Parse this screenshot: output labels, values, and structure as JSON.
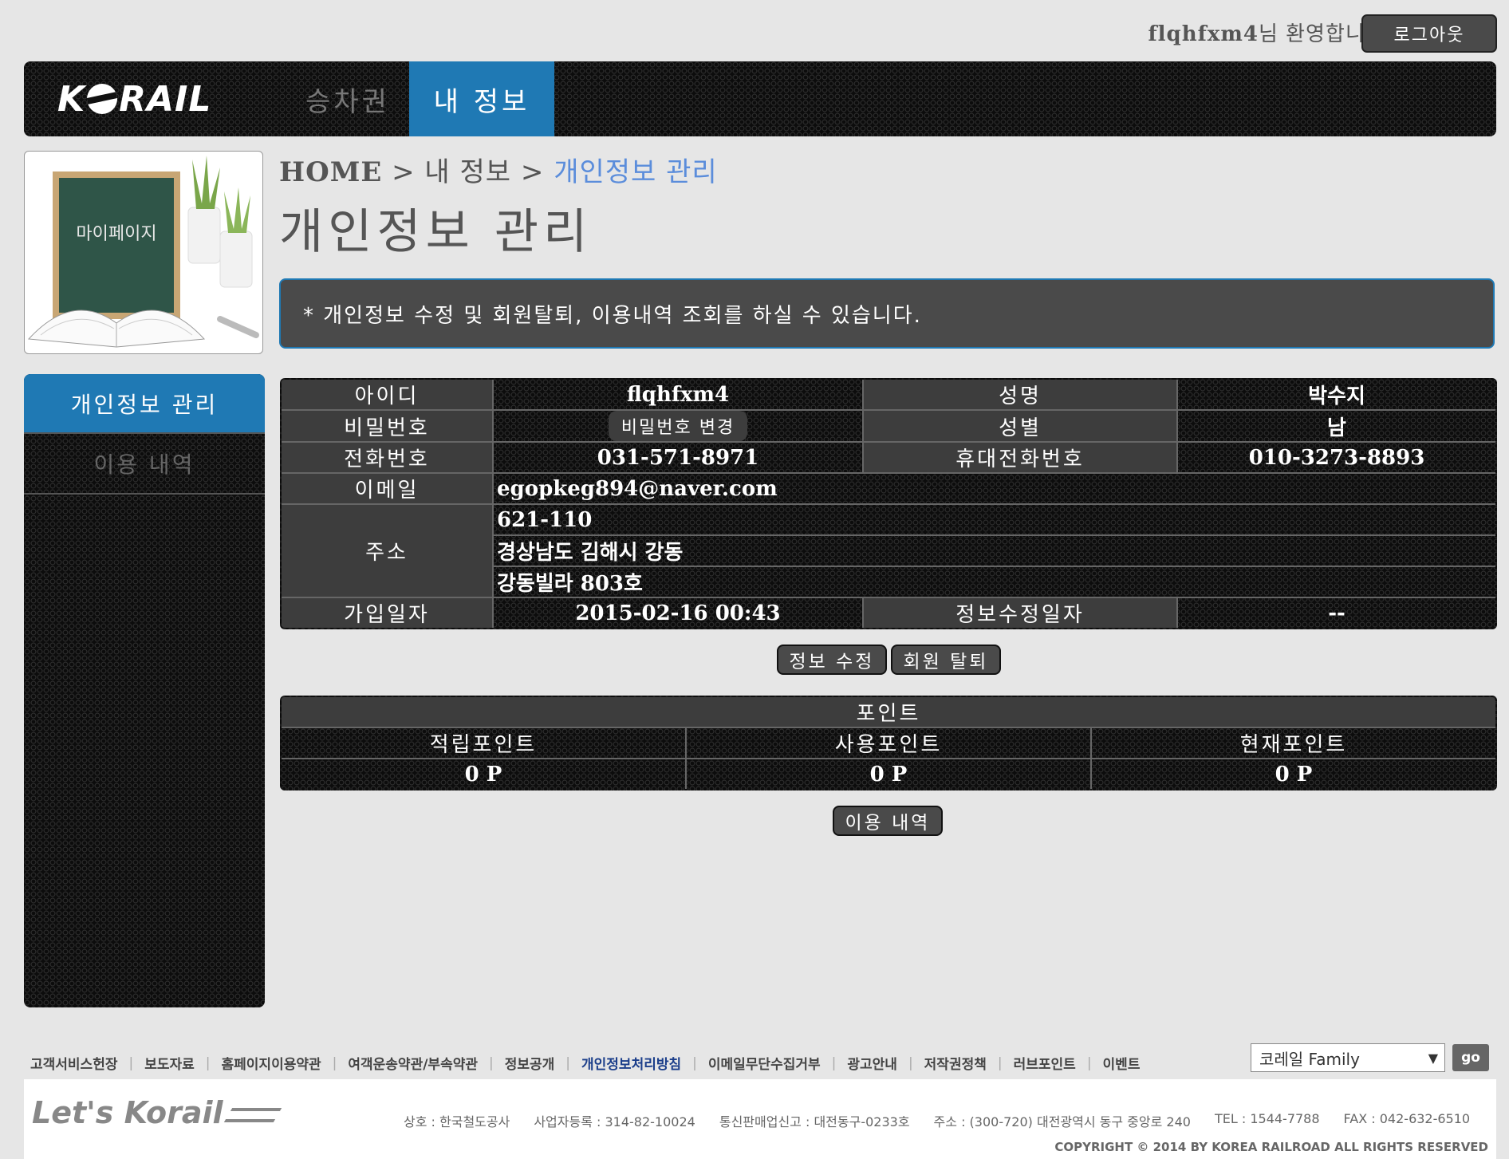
{
  "header": {
    "username": "flqhfxm4",
    "welcome_suffix": "님 환영합니다.",
    "logout_label": "로그아웃"
  },
  "nav": {
    "logo_text": "KORAIL",
    "tabs": [
      {
        "label": "승차권",
        "active": false
      },
      {
        "label": "내 정보",
        "active": true
      }
    ]
  },
  "side_image": {
    "chalkboard_text": "마이페이지"
  },
  "breadcrumb": {
    "home": "HOME",
    "sep": ">",
    "section": "내 정보",
    "current": "개인정보 관리"
  },
  "page_title": "개인정보 관리",
  "notice": "* 개인정보 수정 및 회원탈퇴, 이용내역 조회를 하실 수 있습니다.",
  "sidebar": {
    "items": [
      {
        "label": "개인정보 관리",
        "active": true
      },
      {
        "label": "이용 내역",
        "active": false
      }
    ]
  },
  "info": {
    "id_label": "아이디",
    "id_value": "flqhfxm4",
    "name_label": "성명",
    "name_value": "박수지",
    "pw_label": "비밀번호",
    "pw_change_btn": "비밀번호 변경",
    "gender_label": "성별",
    "gender_value": "남",
    "phone_label": "전화번호",
    "phone_value": "031-571-8971",
    "mobile_label": "휴대전화번호",
    "mobile_value": "010-3273-8893",
    "email_label": "이메일",
    "email_value": "egopkeg894@naver.com",
    "address_label": "주소",
    "address_zip": "621-110",
    "address_line1": "경상남도 김해시 강동",
    "address_line2": "강동빌라 803호",
    "join_label": "가입일자",
    "join_value": "2015-02-16 00:43",
    "modified_label": "정보수정일자",
    "modified_value": "--"
  },
  "buttons": {
    "edit": "정보 수정",
    "withdraw": "회원 탈퇴",
    "history": "이용 내역"
  },
  "points": {
    "title": "포인트",
    "earned_label": "적립포인트",
    "earned_value": "0 P",
    "used_label": "사용포인트",
    "used_value": "0 P",
    "current_label": "현재포인트",
    "current_value": "0 P"
  },
  "footer": {
    "links": [
      {
        "label": "고객서비스헌장"
      },
      {
        "label": "보도자료"
      },
      {
        "label": "홈페이지이용약관"
      },
      {
        "label": "여객운송약관/부속약관"
      },
      {
        "label": "정보공개"
      },
      {
        "label": "개인정보처리방침"
      },
      {
        "label": "이메일무단수집거부"
      },
      {
        "label": "광고안내"
      },
      {
        "label": "저작권정책"
      },
      {
        "label": "러브포인트"
      },
      {
        "label": "이벤트"
      }
    ],
    "family_select": "코레일 Family",
    "go_label": "go",
    "logo_text": "Let's Korail",
    "company": "상호 : 한국철도공사",
    "business_no": "사업자등록 : 314-82-10024",
    "mail_order": "통신판매업신고 : 대전동구-0233호",
    "address": "주소 : (300-720) 대전광역시 동구 중앙로 240",
    "tel": "TEL : 1544-7788",
    "fax": "FAX : 042-632-6510",
    "copyright": "COPYRIGHT © 2014 BY KOREA RAILROAD  ALL RIGHTS RESERVED"
  },
  "colors": {
    "accent_blue": "#1f79b4",
    "breadcrumb_blue": "#5b8ddb",
    "panel_gray": "#4a4a4a",
    "background": "#e6e6e6"
  }
}
